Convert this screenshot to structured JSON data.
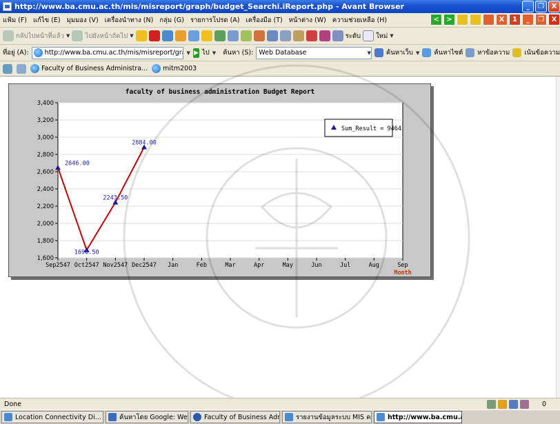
{
  "window": {
    "title": "http://www.ba.cmu.ac.th/mis/misreport/graph/budget_Searchi.iReport.php - Avant Browser",
    "minimize_label": "_",
    "maximize_label": "❐",
    "close_label": "X"
  },
  "menubar": {
    "items": [
      {
        "label": "แฟ้ม (F)"
      },
      {
        "label": "แก้ไข (E)"
      },
      {
        "label": "มุมมอง (V)"
      },
      {
        "label": "เครื่องนำทาง (N)"
      },
      {
        "label": "กลุ่ม (G)"
      },
      {
        "label": "รายการโปรด (A)"
      },
      {
        "label": "เครื่องมือ (T)"
      },
      {
        "label": "หน้าต่าง (W)"
      },
      {
        "label": "ความช่วยเหลือ (H)"
      }
    ],
    "tool_squares": [
      "<",
      ">",
      "",
      "",
      "",
      "X",
      "1",
      "_",
      "❐",
      "X"
    ]
  },
  "toolbar": {
    "back_label": "กลับไปหน้าที่แล้ว",
    "forward_label": "ไปยังหน้าถัดไป",
    "tab_label": "ระดับ",
    "new_label": "ใหม่"
  },
  "addressbar": {
    "label": "ที่อยู่ (A):",
    "url": "http://www.ba.cmu.ac.th/mis/misreport/graph/budget_Search",
    "go_label": "ไป",
    "search_label": "ค้นหา (S):",
    "search_value": "Web Database",
    "search_web": "ค้นหาเว็บ",
    "search_site": "ค้นหาไซต์",
    "find_text": "หาข้อความ",
    "highlight": "เน้นข้อความ"
  },
  "linkbar": {
    "tab1": "Faculty of Business Administra...",
    "tab2": "mitm2003"
  },
  "colors": {
    "line": "#cc0000",
    "marker": "#1a1a9a",
    "label": "#1a1acc",
    "axis_title": "#cc3300",
    "chart_bg": "#ffffff",
    "frame_bg": "#c8c8c8"
  },
  "chart_data": {
    "type": "line",
    "title": "faculty of business administration Budget Report",
    "categories": [
      "Sep2547",
      "Oct2547",
      "Nov2547",
      "Dec2547",
      "Jan",
      "Feb",
      "Mar",
      "Apr",
      "May",
      "Jun",
      "Jul",
      "Aug",
      "Sep"
    ],
    "series": [
      {
        "name": "Sum_Result = 9464",
        "x": [
          "Sep2547",
          "Oct2547",
          "Nov2547",
          "Dec2547"
        ],
        "values": [
          2646.0,
          1690.5,
          2243.5,
          2884.0
        ],
        "labels": [
          "2646.00",
          "1690.50",
          "2243.50",
          "2884.00"
        ]
      }
    ],
    "yticks": [
      "1,600",
      "1,800",
      "2,000",
      "2,200",
      "2,400",
      "2,600",
      "2,800",
      "3,000",
      "3,200",
      "3,400"
    ],
    "ylim": [
      1600,
      3400
    ],
    "xlabel": "Month",
    "ylabel": "",
    "grid": true,
    "legend": "top-right"
  },
  "status": {
    "text": "Done",
    "count": "0"
  },
  "taskbar": {
    "items": [
      {
        "label": "Location Connectivity Di...",
        "active": false
      },
      {
        "label": "ค้นหาโดย Google: Web ...",
        "active": false
      },
      {
        "label": "Faculty of Business Admi...",
        "active": false
      },
      {
        "label": "รายงานข้อมูลระบบ MIS ค...",
        "active": false
      },
      {
        "label": "http://www.ba.cmu.a...",
        "active": true
      }
    ]
  }
}
